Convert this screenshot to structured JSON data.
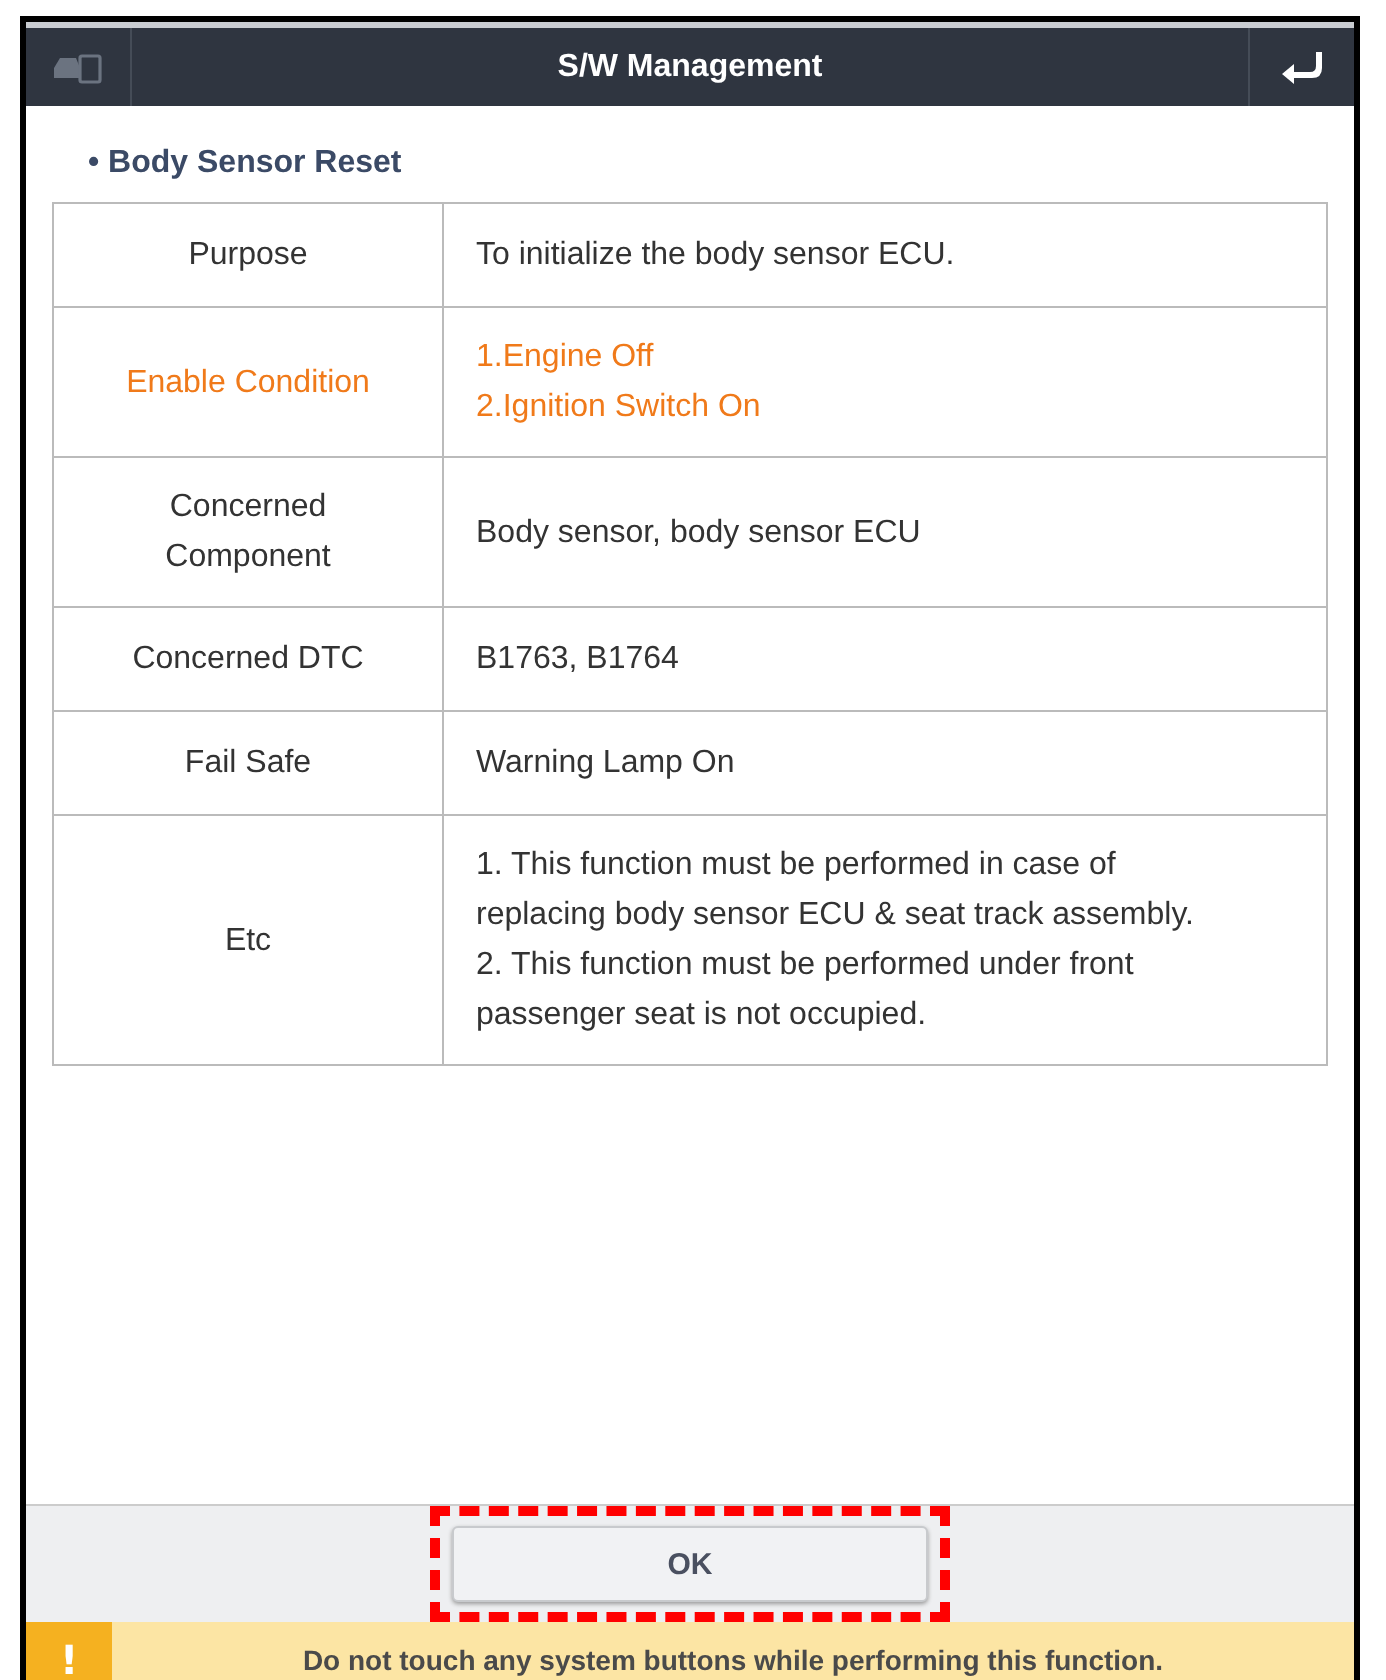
{
  "header": {
    "title": "S/W Management"
  },
  "section_title": "• Body Sensor Reset",
  "rows": [
    {
      "label": [
        "Purpose"
      ],
      "value": [
        "To initialize the body sensor ECU."
      ],
      "highlight": false
    },
    {
      "label": [
        "Enable Condition"
      ],
      "value": [
        "1.Engine Off",
        "2.Ignition Switch On"
      ],
      "highlight": true
    },
    {
      "label": [
        "Concerned",
        "Component"
      ],
      "value": [
        "Body sensor, body sensor ECU"
      ],
      "highlight": false
    },
    {
      "label": [
        "Concerned DTC"
      ],
      "value": [
        "B1763, B1764"
      ],
      "highlight": false
    },
    {
      "label": [
        "Fail Safe"
      ],
      "value": [
        "Warning Lamp On"
      ],
      "highlight": false
    },
    {
      "label": [
        "Etc"
      ],
      "value": [
        "1. This function must be performed in case of replacing body sensor ECU & seat track assembly.",
        "2. This function must be performed under front passenger seat is not occupied."
      ],
      "highlight": false
    }
  ],
  "ok_button": {
    "label": "OK",
    "highlighted": true
  },
  "warning": {
    "icon": "!",
    "text": "Do not touch any system buttons while performing this function."
  }
}
